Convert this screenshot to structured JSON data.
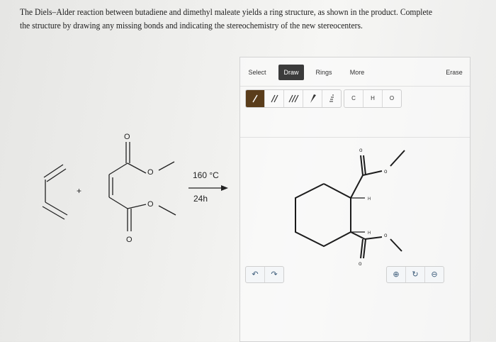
{
  "question": {
    "line1": "The Diels–Alder reaction between butadiene and dimethyl maleate yields a ring structure, as shown in the product. Complete",
    "line2": "the structure by drawing any missing bonds and indicating the stereochemistry of the new stereocenters."
  },
  "scheme": {
    "plus": "+",
    "temperature": "160 °C",
    "time": "24h",
    "oxygen": "O"
  },
  "editor": {
    "tabs": [
      "Select",
      "Draw",
      "Rings",
      "More",
      "Erase"
    ],
    "active_tab": "Draw",
    "bond_tools": [
      "/",
      "//",
      "///",
      "wedge",
      "hash"
    ],
    "atom_tools": [
      "C",
      "H",
      "O"
    ],
    "undo": "↶",
    "redo": "↷",
    "zoom_in": "⊕",
    "zoom_reset": "↻",
    "zoom_out": "⊖",
    "product_labels": {
      "o": "o",
      "h": "H"
    }
  }
}
